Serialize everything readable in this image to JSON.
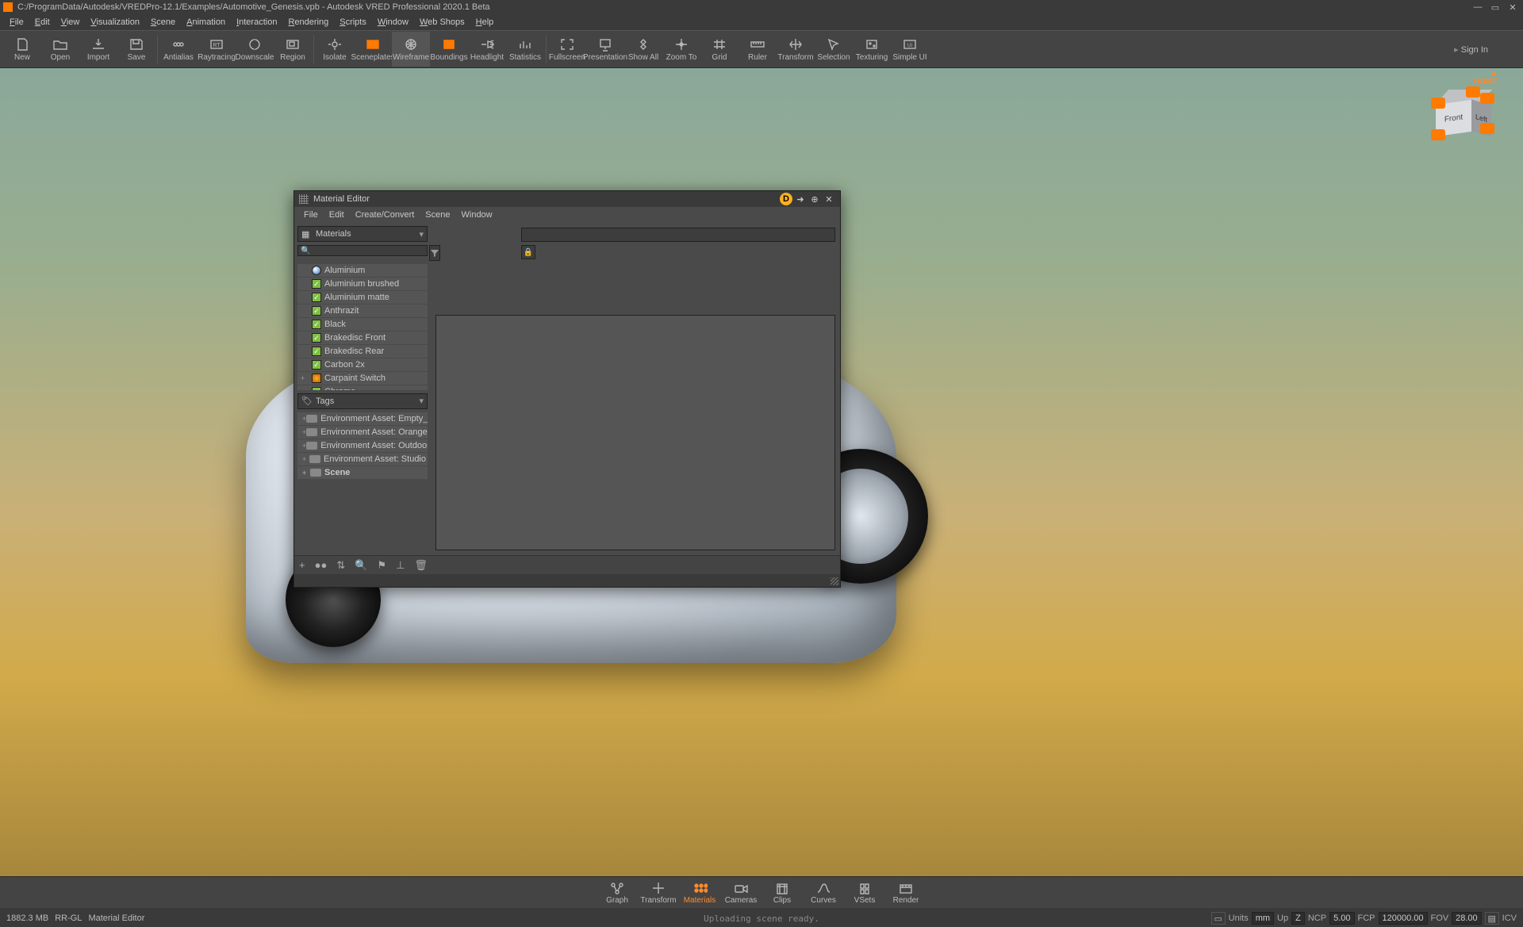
{
  "title": "C:/ProgramData/Autodesk/VREDPro-12.1/Examples/Automotive_Genesis.vpb - Autodesk VRED Professional 2020.1 Beta",
  "mainmenu": [
    "File",
    "Edit",
    "View",
    "Visualization",
    "Scene",
    "Animation",
    "Interaction",
    "Rendering",
    "Scripts",
    "Window",
    "Web Shops",
    "Help"
  ],
  "toolbar": [
    {
      "label": "New"
    },
    {
      "label": "Open"
    },
    {
      "label": "Import"
    },
    {
      "label": "Save"
    },
    {
      "label": "Antialias"
    },
    {
      "label": "Raytracing"
    },
    {
      "label": "Downscale"
    },
    {
      "label": "Region"
    },
    {
      "label": "Isolate"
    },
    {
      "label": "Sceneplates"
    },
    {
      "label": "Wireframe"
    },
    {
      "label": "Boundings"
    },
    {
      "label": "Headlight"
    },
    {
      "label": "Statistics"
    },
    {
      "label": "Fullscreen"
    },
    {
      "label": "Presentation"
    },
    {
      "label": "Show All"
    },
    {
      "label": "Zoom To"
    },
    {
      "label": "Grid"
    },
    {
      "label": "Ruler"
    },
    {
      "label": "Transform"
    },
    {
      "label": "Selection"
    },
    {
      "label": "Texturing"
    },
    {
      "label": "Simple UI"
    }
  ],
  "signin": "Sign In",
  "viewcube": {
    "home": "HOME",
    "front": "Front",
    "left": "Left"
  },
  "material_editor": {
    "title": "Material Editor",
    "menu": [
      "File",
      "Edit",
      "Create/Convert",
      "Scene",
      "Window"
    ],
    "combo_materials": "Materials",
    "combo_tags": "Tags",
    "search_placeholder": "",
    "materials": [
      {
        "name": "Aluminium",
        "sw": "cir"
      },
      {
        "name": "Aluminium brushed",
        "sw": "grn"
      },
      {
        "name": "Aluminium matte",
        "sw": "grn"
      },
      {
        "name": "Anthrazit",
        "sw": "grn"
      },
      {
        "name": "Black",
        "sw": "grn"
      },
      {
        "name": "Brakedisc Front",
        "sw": "grn"
      },
      {
        "name": "Brakedisc Rear",
        "sw": "grn"
      },
      {
        "name": "Carbon 2x",
        "sw": "grn"
      },
      {
        "name": "Carpaint Switch",
        "sw": "org",
        "exp": "+"
      },
      {
        "name": "Chrome",
        "sw": "grn"
      }
    ],
    "tags": [
      {
        "label": "Environment Asset: Empty_Garage",
        "exp": "+"
      },
      {
        "label": "Environment Asset: Orange_Sea...",
        "exp": "+"
      },
      {
        "label": "Environment Asset: Outdoor_Sta...",
        "exp": "+"
      },
      {
        "label": "Environment Asset: Studio",
        "exp": "+"
      },
      {
        "label": "Scene",
        "exp": "+",
        "bold": true
      }
    ]
  },
  "quickbar": [
    "Graph",
    "Transform",
    "Materials",
    "Cameras",
    "Clips",
    "Curves",
    "VSets",
    "Render"
  ],
  "quickbar_active": "Materials",
  "status": {
    "mem": "1882.3 MB",
    "renderer": "RR-GL",
    "context": "Material Editor",
    "center": "Uploading scene ready.",
    "units_label": "Units",
    "units": "mm",
    "up_label": "Up",
    "up": "Z",
    "ncp_label": "NCP",
    "ncp": "5.00",
    "fcp_label": "FCP",
    "fcp": "120000.00",
    "fov_label": "FOV",
    "fov": "28.00",
    "icv": "ICV"
  }
}
